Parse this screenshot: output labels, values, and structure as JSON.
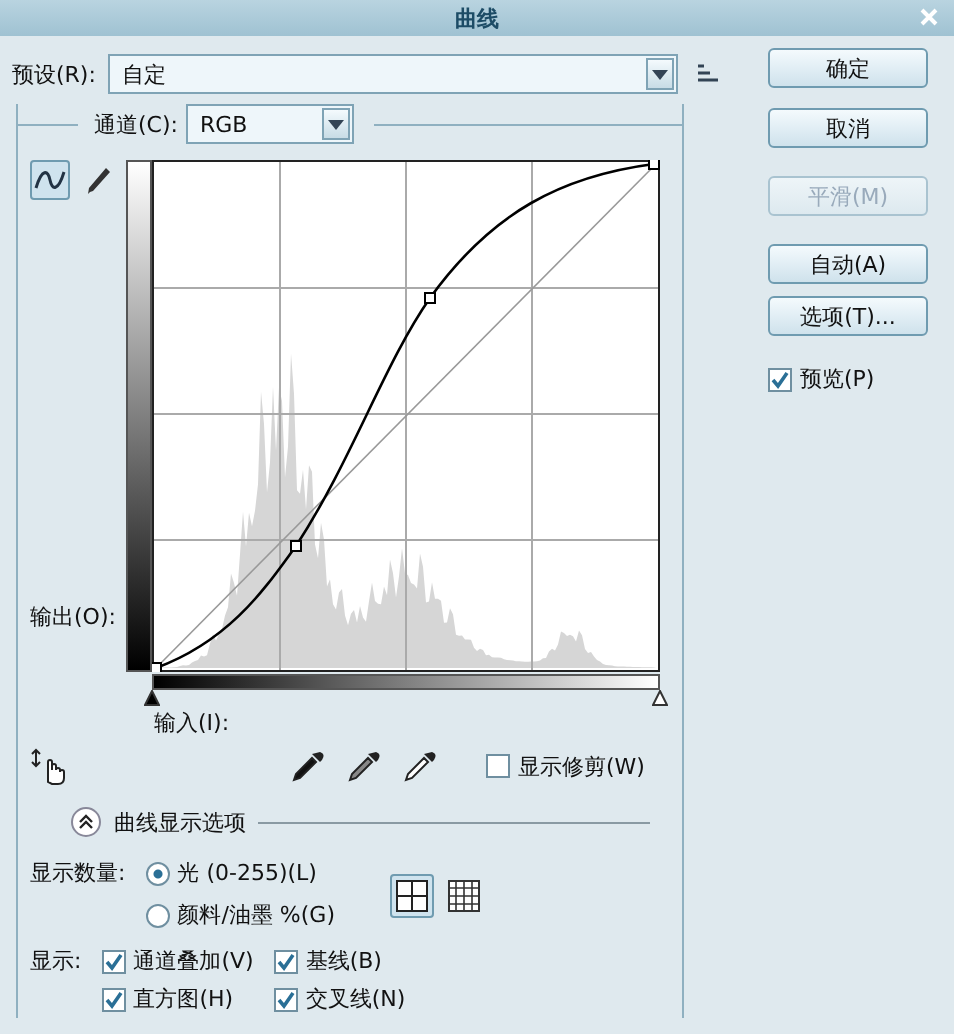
{
  "window": {
    "title": "曲线"
  },
  "preset": {
    "label": "预设(R):",
    "value": "自定"
  },
  "channel": {
    "label": "通道(C):",
    "value": "RGB"
  },
  "tools": [
    {
      "kind": "curve",
      "selected": true
    },
    {
      "kind": "pencil",
      "selected": false
    }
  ],
  "output_label": "输出(O):",
  "input_sliders": [
    {
      "kind": "shadow",
      "level": 0
    },
    {
      "kind": "highlight",
      "level": 1
    }
  ],
  "input_label": "输入(I):",
  "show_clipping": {
    "label": "显示修剪(W)",
    "checked": false
  },
  "display_options": {
    "label": "曲线显示选项",
    "expanded": true
  },
  "show_amount": {
    "label": "显示数量:",
    "options": [
      {
        "label": "光 (0-255)(L)",
        "selected": true
      },
      {
        "label": "颜料/油墨 %(G)",
        "selected": false
      }
    ]
  },
  "grid_options": [
    {
      "kind": "coarse",
      "selected": true
    },
    {
      "kind": "fine",
      "selected": false
    }
  ],
  "show": {
    "label": "显示:",
    "options": [
      {
        "label": "通道叠加(V)",
        "checked": true
      },
      {
        "label": "基线(B)",
        "checked": true
      },
      {
        "label": "直方图(H)",
        "checked": true
      },
      {
        "label": "交叉线(N)",
        "checked": true
      }
    ]
  },
  "buttons": [
    {
      "label": "确定",
      "disabled": false
    },
    {
      "label": "取消",
      "disabled": false
    },
    {
      "label": "平滑(M)",
      "disabled": true
    },
    {
      "label": "自动(A)",
      "disabled": false
    },
    {
      "label": "选项(T)...",
      "disabled": false
    }
  ],
  "preview": {
    "label": "预览(P)",
    "checked": true
  }
}
